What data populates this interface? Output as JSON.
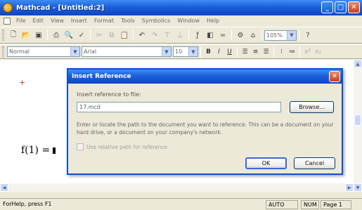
{
  "window": {
    "title": "Mathcad - [Untitled:2]"
  },
  "menu": [
    "File",
    "Edit",
    "View",
    "Insert",
    "Format",
    "Tools",
    "Symbolics",
    "Window",
    "Help"
  ],
  "toolbar": {
    "zoom": "105%"
  },
  "format_bar": {
    "style": "Normal",
    "font": "Arial",
    "size": "10"
  },
  "document": {
    "expression": "f(1) ="
  },
  "status": {
    "help": "ForHelp, press F1",
    "mode": "AUTO",
    "num": "NUM",
    "page": "Page 1"
  },
  "dialog": {
    "title": "Insert Reference",
    "label": "Insert reference to file:",
    "file_value": "17.mcd",
    "browse": "Browse...",
    "description": "Enter or locate the path to the document you want to reference. This can be a document on your hard drive, or a document on your company's network.",
    "checkbox": "Use relative path for reference",
    "ok": "OK",
    "cancel": "Cancel"
  }
}
